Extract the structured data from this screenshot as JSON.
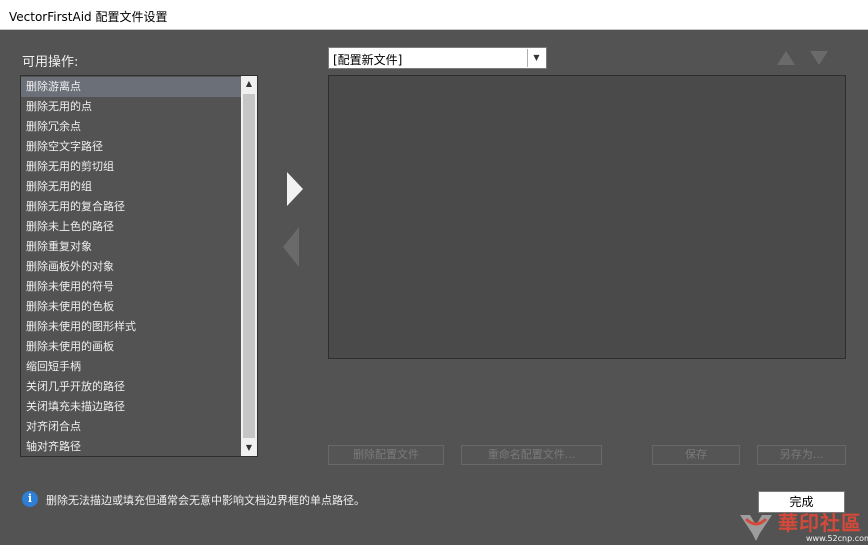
{
  "window": {
    "title": "VectorFirstAid 配置文件设置"
  },
  "available_ops_label": "可用操作:",
  "operations": [
    "删除游离点",
    "删除无用的点",
    "删除冗余点",
    "删除空文字路径",
    "删除无用的剪切组",
    "删除无用的组",
    "删除无用的复合路径",
    "删除未上色的路径",
    "删除重复对象",
    "删除画板外的对象",
    "删除未使用的符号",
    "删除未使用的色板",
    "删除未使用的图形样式",
    "删除未使用的画板",
    "缩回短手柄",
    "关闭几乎开放的路径",
    "关闭填充未描边路径",
    "对齐闭合点",
    "轴对齐路径"
  ],
  "selected_index": 0,
  "profile_select": {
    "value": "[配置新文件]"
  },
  "buttons": {
    "delete_profile": "删除配置文件",
    "rename_profile": "重命名配置文件...",
    "save": "保存",
    "save_as": "另存为...",
    "done": "完成"
  },
  "info_text": "删除无法描边或填充但通常会无意中影响文档边界框的单点路径。",
  "watermark": {
    "logo": "華印社區",
    "url": "www.52cnp.com"
  },
  "colors": {
    "background": "#535353",
    "panel": "#4a4a4a",
    "selection": "#6b6f78",
    "info": "#2d7fd6",
    "watermark": "#d44a3a"
  },
  "icons": [
    "info-icon",
    "move-right-arrow-icon",
    "move-left-arrow-icon",
    "move-up-icon",
    "move-down-icon",
    "dropdown-arrow-icon"
  ]
}
